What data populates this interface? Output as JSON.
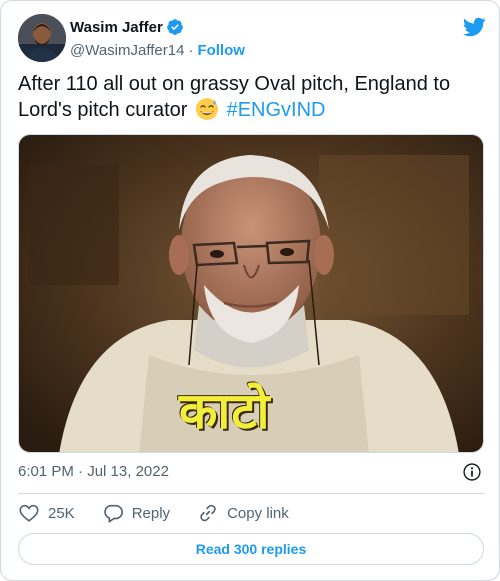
{
  "author": {
    "display_name": "Wasim Jaffer",
    "handle": "@WasimJaffer14",
    "separator": "·",
    "follow_label": "Follow",
    "verified": true
  },
  "tweet": {
    "text_before_emoji": "After 110 all out on grassy Oval pitch, England to Lord's pitch curator",
    "emoji": "grinning-face-with-sweat",
    "hashtag": "#ENGvIND",
    "image_caption": "काटो"
  },
  "meta": {
    "time": "6:01 PM",
    "separator": "·",
    "date": "Jul 13, 2022"
  },
  "actions": {
    "likes_count": "25K",
    "reply_label": "Reply",
    "copy_link_label": "Copy link"
  },
  "read_replies_label": "Read 300 replies",
  "colors": {
    "accent": "#1d9bf0",
    "text": "#0f1419",
    "secondary_text": "#536471",
    "border": "#cfd9de"
  }
}
